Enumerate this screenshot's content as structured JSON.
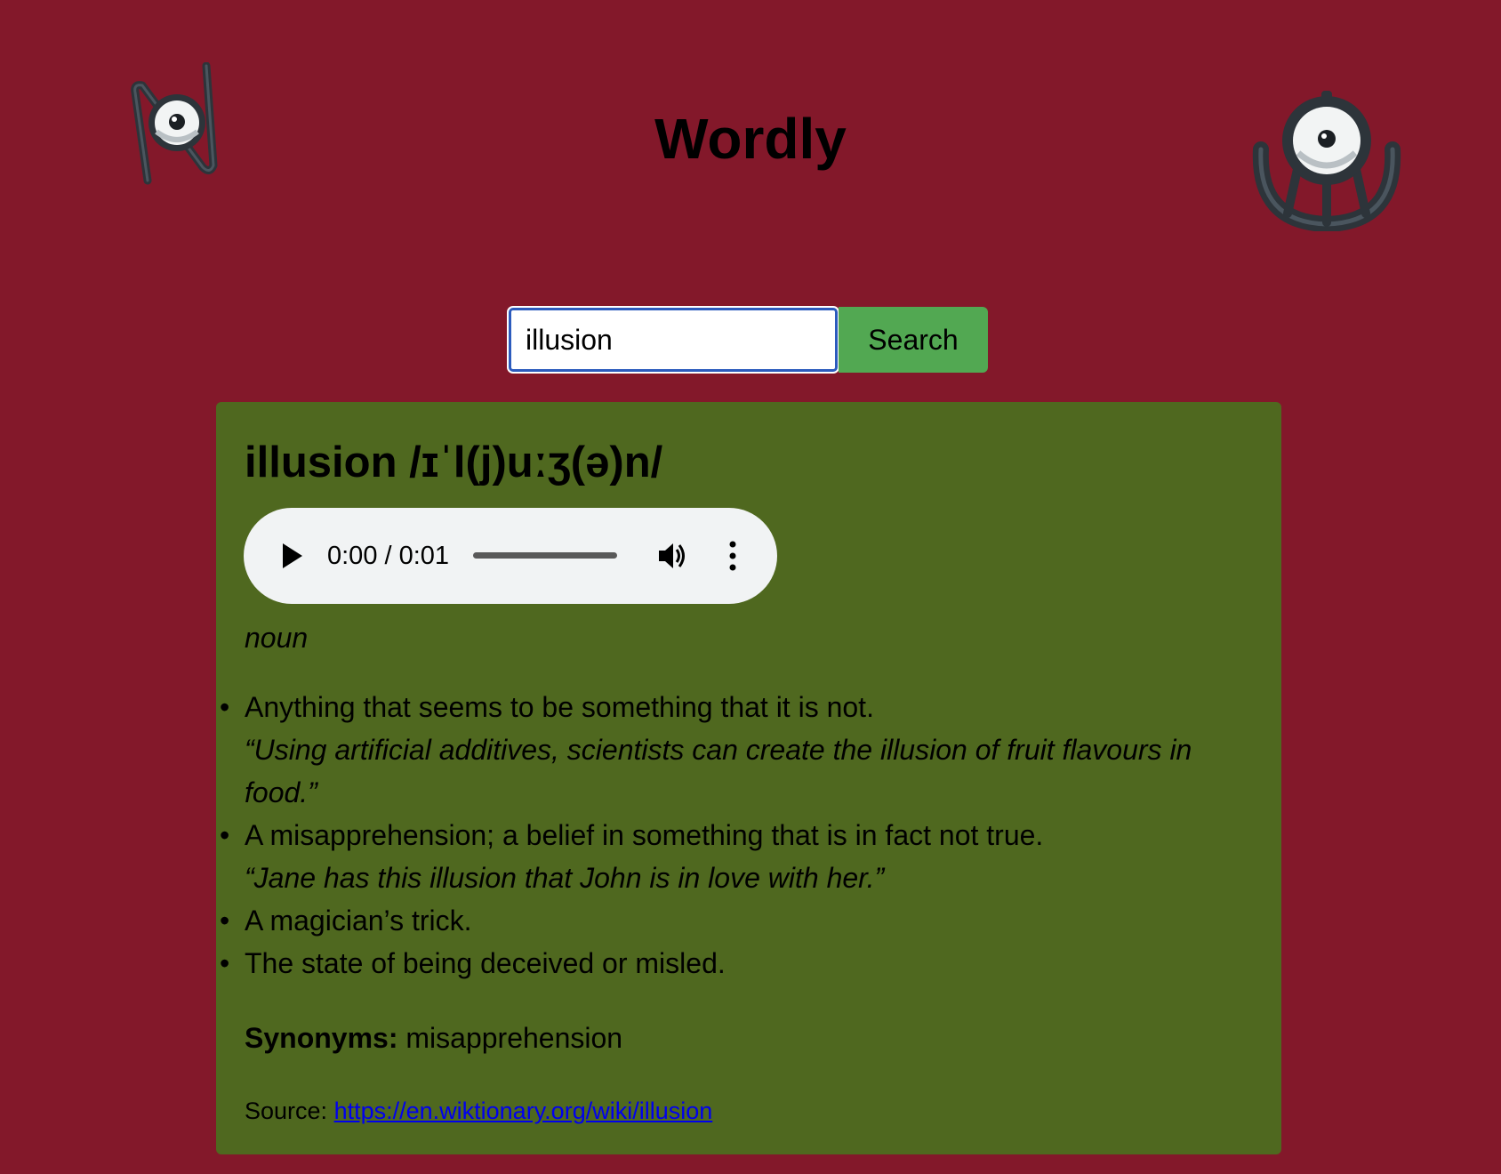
{
  "app": {
    "title": "Wordly"
  },
  "mascots": {
    "left_icon": "unown-n-icon",
    "right_icon": "unown-u-icon"
  },
  "search": {
    "value": "illusion",
    "button_label": "Search"
  },
  "result": {
    "heading": "illusion /ɪˈl(j)uːʒ(ə)n/",
    "audio": {
      "time": "0:00 / 0:01",
      "progress": 0
    },
    "part_of_speech": "noun",
    "definitions": [
      {
        "text": "Anything that seems to be something that it is not.",
        "example": "“Using artificial additives, scientists can create the illusion of fruit flavours in food.”"
      },
      {
        "text": "A misapprehension; a belief in something that is in fact not true.",
        "example": "“Jane has this illusion that John is in love with her.”"
      },
      {
        "text": "A magician’s trick."
      },
      {
        "text": "The state of being deceived or misled."
      }
    ],
    "synonyms_label": "Synonyms:",
    "synonyms": "misapprehension",
    "source_label": "Source:",
    "source_url": "https://en.wiktionary.org/wiki/illusion"
  },
  "colors": {
    "background": "#83182a",
    "card": "#4f681f",
    "search_button": "#52a852",
    "input_border": "#2c5bbd",
    "link": "#0000ee"
  }
}
